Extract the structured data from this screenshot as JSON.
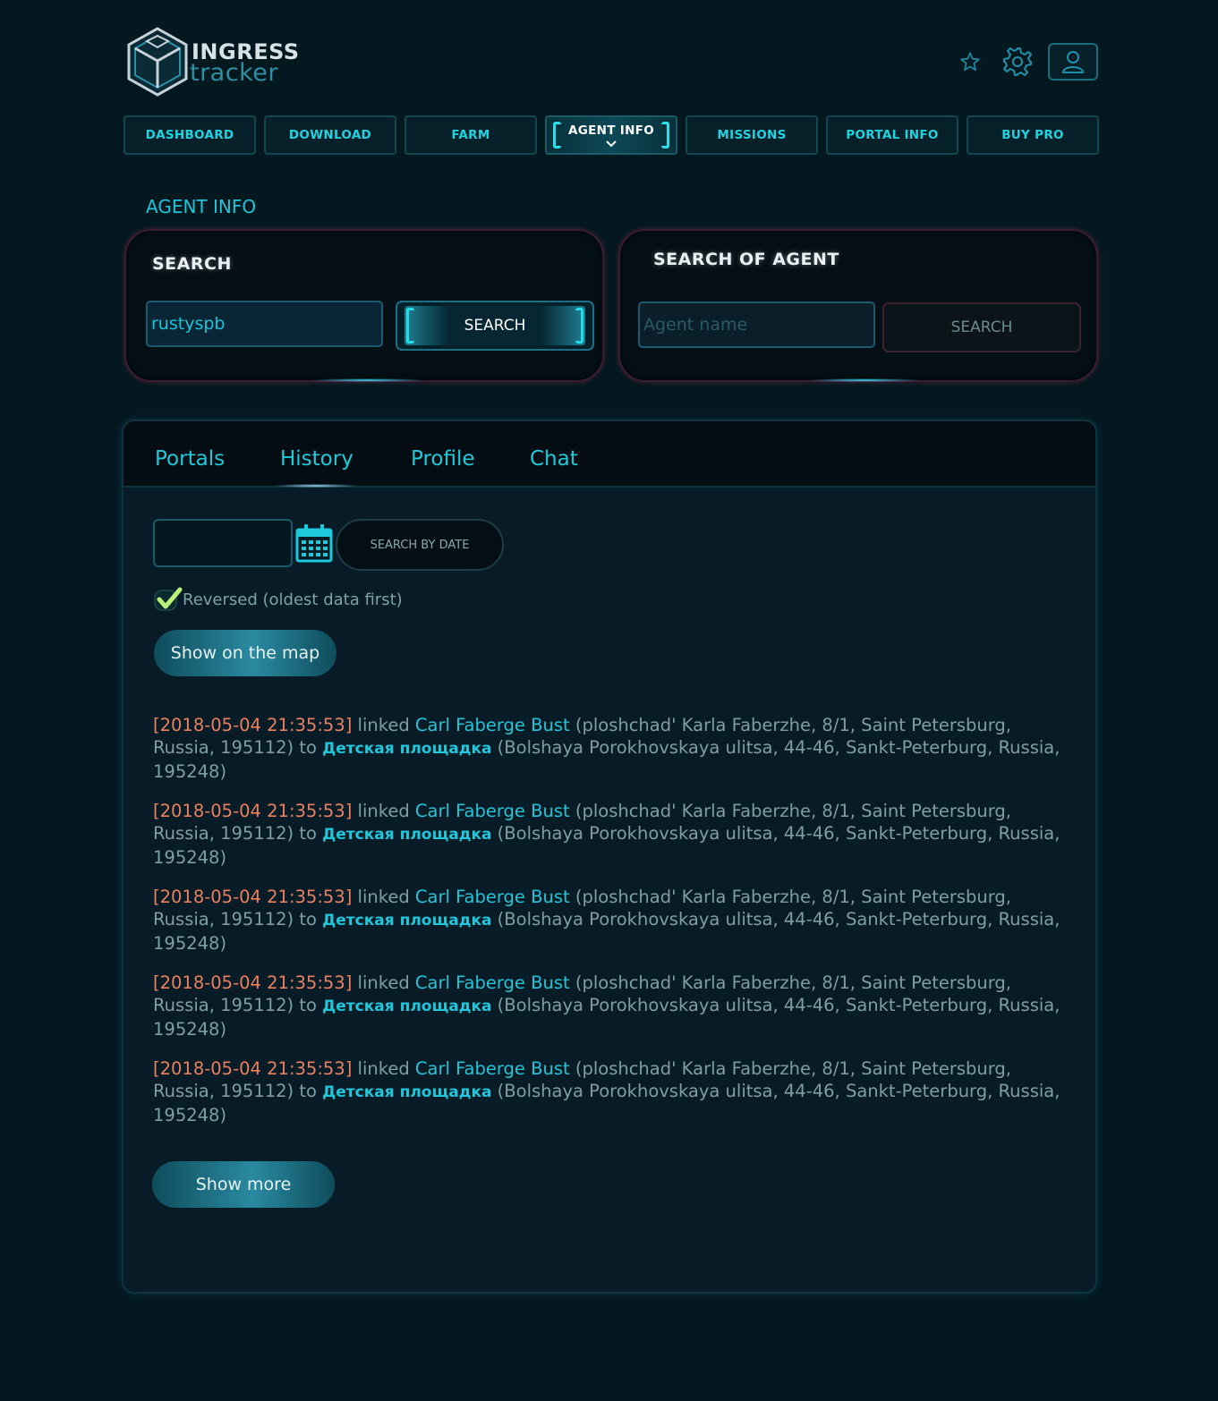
{
  "header": {
    "logo_word1": "INGRESS",
    "logo_word2": "tracker",
    "icons": [
      "star-icon",
      "gear-icon",
      "user-icon"
    ]
  },
  "nav": {
    "items": [
      {
        "label": "DASHBOARD"
      },
      {
        "label": "DOWNLOAD"
      },
      {
        "label": "FARM"
      },
      {
        "label": "AGENT INFO",
        "active": true
      },
      {
        "label": "MISSIONS"
      },
      {
        "label": "PORTAL INFO"
      },
      {
        "label": "BUY PRO"
      }
    ],
    "active_chevron": "⌄"
  },
  "page_title": "AGENT INFO",
  "search_card": {
    "title": "SEARCH",
    "input_value": "rustyspb",
    "button_label": "SEARCH"
  },
  "agent_search_card": {
    "title": "SEARCH OF AGENT",
    "input_placeholder": "Agent name",
    "button_label": "SEARCH"
  },
  "tabs": [
    {
      "label": "Portals"
    },
    {
      "label": "History",
      "active": true
    },
    {
      "label": "Profile"
    },
    {
      "label": "Chat"
    }
  ],
  "filters": {
    "date_value": "",
    "date_button": "SEARCH BY DATE",
    "reversed_label": "Reversed (oldest data first)",
    "reversed_checked": true,
    "show_map_button": "Show on the map"
  },
  "history": [
    {
      "ts": "[2018-05-04 21:35:53]",
      "action": " linked ",
      "portal1": "Carl Faberge Bust",
      "addr1": " (ploshchad' Karla Faberzhe, 8/1, Saint Petersburg, Russia, 195112) to ",
      "portal2": "Детская площадка",
      "addr2": " (Bolshaya Porokhovskaya ulitsa, 44-46, Sankt-Peterburg, Russia, 195248)"
    },
    {
      "ts": "[2018-05-04 21:35:53]",
      "action": " linked ",
      "portal1": "Carl Faberge Bust",
      "addr1": " (ploshchad' Karla Faberzhe, 8/1, Saint Petersburg, Russia, 195112) to ",
      "portal2": "Детская площадка",
      "addr2": " (Bolshaya Porokhovskaya ulitsa, 44-46, Sankt-Peterburg, Russia, 195248)"
    },
    {
      "ts": "[2018-05-04 21:35:53]",
      "action": " linked ",
      "portal1": "Carl Faberge Bust",
      "addr1": " (ploshchad' Karla Faberzhe, 8/1, Saint Petersburg, Russia, 195112) to ",
      "portal2": "Детская площадка",
      "addr2": " (Bolshaya Porokhovskaya ulitsa, 44-46, Sankt-Peterburg, Russia, 195248)"
    },
    {
      "ts": "[2018-05-04 21:35:53]",
      "action": " linked ",
      "portal1": "Carl Faberge Bust",
      "addr1": " (ploshchad' Karla Faberzhe, 8/1, Saint Petersburg, Russia, 195112) to ",
      "portal2": "Детская площадка",
      "addr2": " (Bolshaya Porokhovskaya ulitsa, 44-46, Sankt-Peterburg, Russia, 195248)"
    },
    {
      "ts": "[2018-05-04 21:35:53]",
      "action": " linked ",
      "portal1": "Carl Faberge Bust",
      "addr1": " (ploshchad' Karla Faberzhe, 8/1, Saint Petersburg, Russia, 195112) to ",
      "portal2": "Детская площадка",
      "addr2": " (Bolshaya Porokhovskaya ulitsa, 44-46, Sankt-Peterburg, Russia, 195248)"
    }
  ],
  "show_more_button": "Show more",
  "colors": {
    "background": "#041820",
    "accent": "#1fd4e0",
    "timestamp": "#e9805f",
    "checkmark": "#b8f07a"
  }
}
